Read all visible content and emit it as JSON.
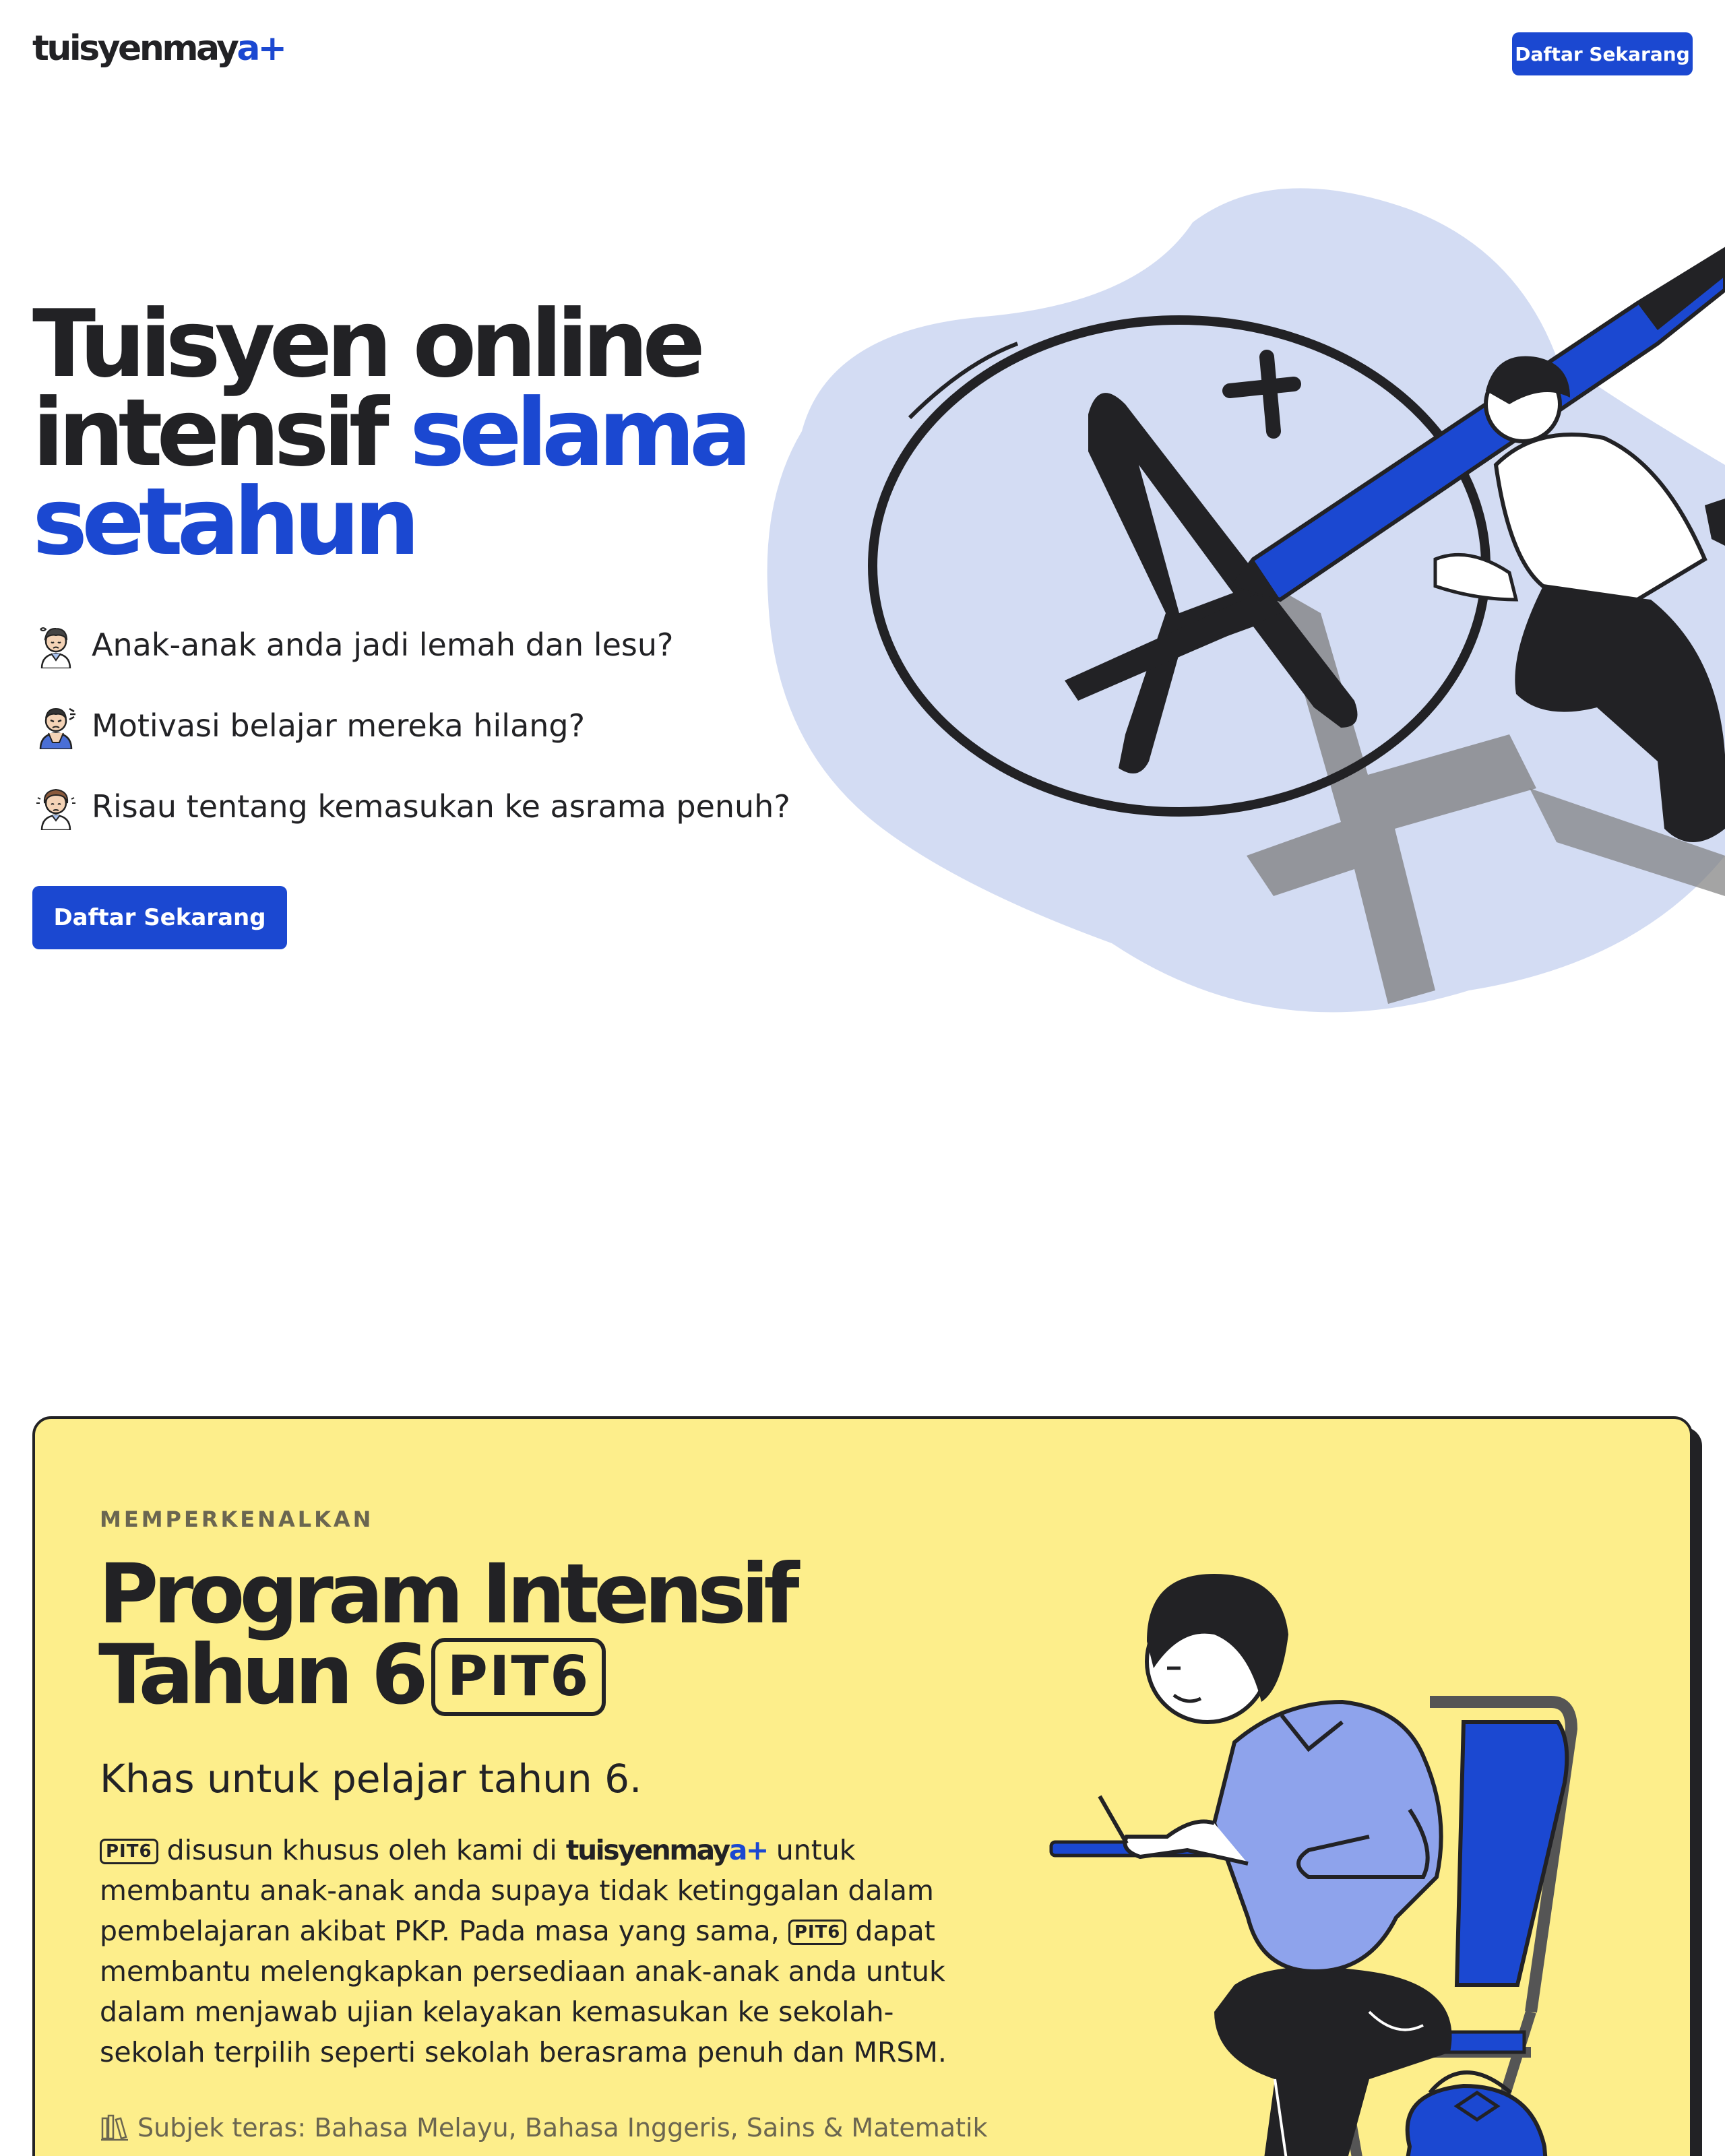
{
  "header": {
    "logo_text": "tuisyenmay",
    "logo_accent": "a",
    "logo_plus": "+",
    "cta_label": "Daftar Sekarang"
  },
  "hero": {
    "title_line1": "Tuisyen online",
    "title_line2_dark": "intensif ",
    "title_line2_blue": "selama",
    "title_line3_blue": "setahun",
    "pain_points": [
      {
        "icon": "tired-child-icon",
        "text": "Anak-anak anda jadi lemah dan lesu?"
      },
      {
        "icon": "frustrated-child-icon",
        "text": "Motivasi belajar mereka hilang?"
      },
      {
        "icon": "worried-parent-icon",
        "text": "Risau tentang kemasukan ke asrama penuh?"
      }
    ],
    "cta_label": "Daftar Sekarang",
    "illustration": "student-writing-a-plus-icon"
  },
  "program": {
    "eyebrow": "MEMPERKENALKAN",
    "title_line1": "Program Intensif",
    "title_line2": "Tahun 6",
    "badge": "PIT6",
    "subtitle": "Khas untuk pelajar tahun 6.",
    "desc_badge": "PIT6",
    "desc_part1": " disusun khusus oleh kami di ",
    "desc_brand": "tuisyenmay",
    "desc_brand_accent": "a+",
    "desc_part2": " untuk membantu anak-anak anda supaya tidak ketinggalan dalam pembelajaran akibat PKP. Pada masa yang sama, ",
    "desc_badge2": "PIT6",
    "desc_part3": " dapat membantu melengkapkan persediaan anak-anak anda untuk dalam menjawab ujian kelayakan kemasukan ke sekolah-sekolah terpilih seperti sekolah berasrama penuh dan MRSM.",
    "subjects": "Subjek teras: Bahasa Melayu, Bahasa Inggeris, Sains & Matematik",
    "illustration": "student-at-desk-icon"
  },
  "colors": {
    "brand_blue": "#1b48d1",
    "blob_blue": "#d3dcf3",
    "card_yellow": "#fdee8b",
    "ink": "#222225"
  }
}
